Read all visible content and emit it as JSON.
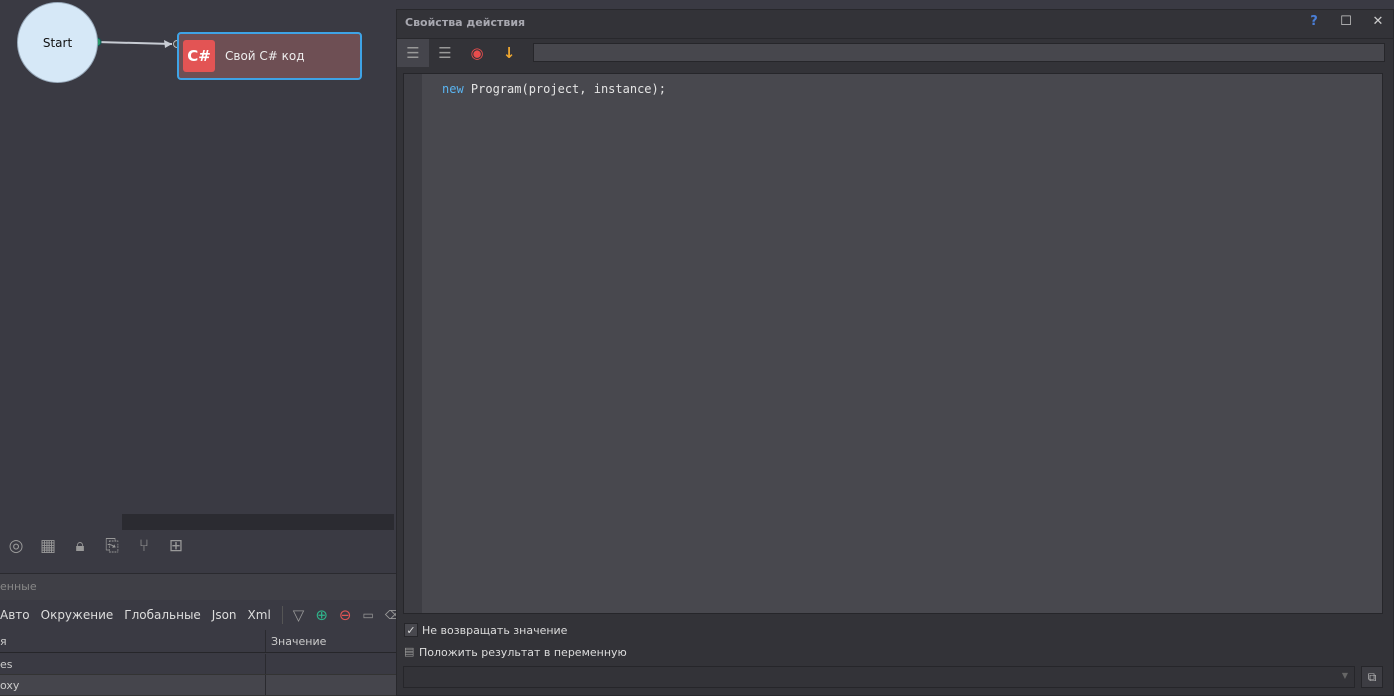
{
  "canvas": {
    "start_label": "Start",
    "node_badge": "C#",
    "node_label": "Свой C# код"
  },
  "bottom": {
    "section_title": "енные",
    "tabs": [
      "Авто",
      "Окружение",
      "Глобальные",
      "Json",
      "Xml"
    ],
    "columns": [
      "я",
      "Значение"
    ],
    "rows": [
      {
        "name": "es",
        "value": ""
      },
      {
        "name": "oxy",
        "value": ""
      }
    ]
  },
  "panel": {
    "title": "Свойства действия",
    "help": "?",
    "maximize": "☐",
    "close": "✕",
    "code_keyword": "new",
    "code_rest": " Program(project, instance);",
    "no_return_label": "Не возвращать значение",
    "no_return_checked": true,
    "save_result_label": "Положить результат в переменную",
    "result_variable": ""
  },
  "colors": {
    "accent": "#3ea3e6",
    "record": "#e84d4d",
    "arrow": "#f0a830"
  }
}
